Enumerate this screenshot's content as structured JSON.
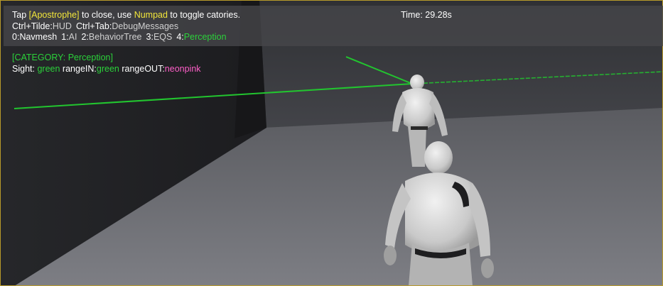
{
  "hud": {
    "line1": {
      "tap": "Tap",
      "key": "[Apostrophe]",
      "mid": "to close, use",
      "numpad": "Numpad",
      "tail": "to toggle catories."
    },
    "line2": {
      "k1": "Ctrl+Tilde:",
      "v1": "HUD",
      "k2": "Ctrl+Tab:",
      "v2": "DebugMessages"
    },
    "line3": {
      "c0k": "0:",
      "c0v": "Navmesh",
      "c1k": "1:",
      "c1v": "AI",
      "c2k": "2:",
      "c2v": "BehaviorTree",
      "c3k": "3:",
      "c3v": "EQS",
      "c4k": "4:",
      "c4v": "Perception"
    },
    "timer": "Time: 29.28s",
    "category": "[CATEGORY: Perception]",
    "legend": {
      "sight": "Sight:",
      "sight_color": "green",
      "in_label": "rangeIN:",
      "in_color": "green",
      "out_label": "rangeOUT:",
      "out_color": "neonpink"
    }
  },
  "colors": {
    "highlight_yellow": "#f2e63a",
    "active_green": "#2bd13a",
    "neonpink": "#ff5fc9",
    "frame_gold": "#b89a2a"
  }
}
